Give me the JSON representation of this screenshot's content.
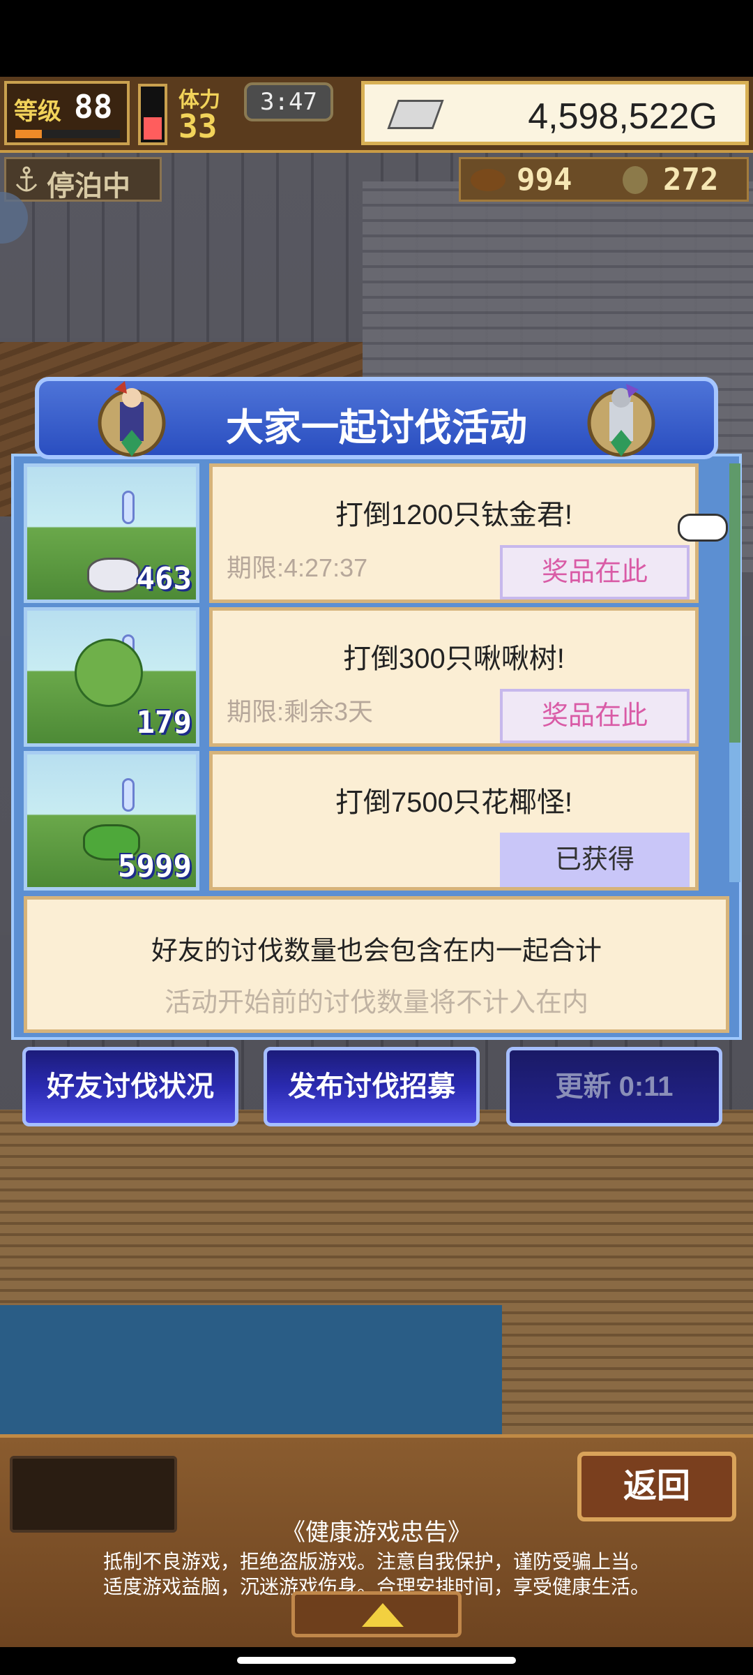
{
  "header": {
    "level_label": "等级",
    "level_value": "88",
    "level_progress": 0.25,
    "stamina_label": "体力",
    "stamina_value": "33",
    "stamina_gauge": 0.4,
    "time": "3:47",
    "gold": "4,598,522G"
  },
  "status": {
    "dock_status": "停泊中",
    "resource1": "994",
    "resource2": "272"
  },
  "dialog": {
    "title": "大家一起讨伐活动",
    "events": [
      {
        "title": "打倒1200只钛金君!",
        "deadline": "期限:4:27:37",
        "count": "463",
        "button": "奖品在此",
        "claimed": false
      },
      {
        "title": "打倒300只啾啾树!",
        "deadline": "期限:剩余3天",
        "count": "179",
        "button": "奖品在此",
        "claimed": false
      },
      {
        "title": "打倒7500只花椰怪!",
        "deadline": "",
        "count": "5999",
        "button": "已获得",
        "claimed": true
      }
    ],
    "info_line1": "好友的讨伐数量也会包含在内一起合计",
    "info_line2": "活动开始前的讨伐数量将不计入在内"
  },
  "buttons": {
    "friend_status": "好友讨伐状况",
    "publish_recruit": "发布讨伐招募",
    "refresh": "更新 0:11"
  },
  "footer": {
    "back": "返回",
    "advice_title": "《健康游戏忠告》",
    "advice_line1": "抵制不良游戏，拒绝盗版游戏。注意自我保护，谨防受骗上当。",
    "advice_line2": "适度游戏益脑，沉迷游戏伤身。合理安排时间，享受健康生活。"
  },
  "colors": {
    "accent_blue": "#2a4ec0",
    "prize_pink": "#d95ba6",
    "card_bg": "#fbeed4"
  }
}
